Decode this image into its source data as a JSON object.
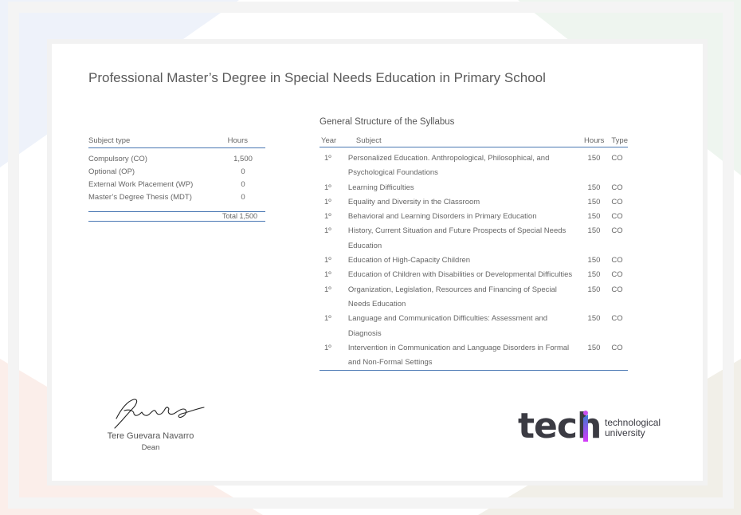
{
  "title": "Professional Master’s Degree in Special Needs Education in Primary School",
  "summary": {
    "headers": {
      "subject_type": "Subject type",
      "hours": "Hours"
    },
    "rows": [
      {
        "label": "Compulsory (CO)",
        "hours": "1,500"
      },
      {
        "label": "Optional (OP)",
        "hours": "0"
      },
      {
        "label": "External Work Placement (WP)",
        "hours": "0"
      },
      {
        "label": "Master’s Degree Thesis (MDT)",
        "hours": "0"
      }
    ],
    "total": "Total 1,500"
  },
  "syllabus": {
    "title": "General Structure of the Syllabus",
    "headers": {
      "year": "Year",
      "subject": "Subject",
      "hours": "Hours",
      "type": "Type"
    },
    "rows": [
      {
        "year": "1º",
        "subject": "Personalized Education. Anthropological, Philosophical, and Psychological Foundations",
        "hours": "150",
        "type": "CO"
      },
      {
        "year": "1º",
        "subject": "Learning Difficulties",
        "hours": "150",
        "type": "CO"
      },
      {
        "year": "1º",
        "subject": "Equality and Diversity in the Classroom",
        "hours": "150",
        "type": "CO"
      },
      {
        "year": "1º",
        "subject": "Behavioral and Learning Disorders in Primary Education",
        "hours": "150",
        "type": "CO"
      },
      {
        "year": "1º",
        "subject": "History, Current Situation and Future Prospects of Special Needs Education",
        "hours": "150",
        "type": "CO"
      },
      {
        "year": "1º",
        "subject": "Education of High-Capacity Children",
        "hours": "150",
        "type": "CO"
      },
      {
        "year": "1º",
        "subject": "Education of Children with Disabilities or Developmental Difficulties",
        "hours": "150",
        "type": "CO"
      },
      {
        "year": "1º",
        "subject": "Organization, Legislation, Resources and Financing of Special Needs Education",
        "hours": "150",
        "type": "CO"
      },
      {
        "year": "1º",
        "subject": "Language and Communication Difficulties: Assessment and Diagnosis",
        "hours": "150",
        "type": "CO"
      },
      {
        "year": "1º",
        "subject": "Intervention in Communication and Language Disorders in Formal and Non-Formal Settings",
        "hours": "150",
        "type": "CO"
      }
    ]
  },
  "signature": {
    "name": "Tere Guevara Navarro",
    "role": "Dean"
  },
  "logo": {
    "word": "tech",
    "tagline_1": "technological",
    "tagline_2": "university"
  },
  "colors": {
    "accent_line": "#4a78b3",
    "logo_text": "#3b3b43",
    "logo_gradient": [
      "#3a7bd5",
      "#d63af9"
    ]
  }
}
